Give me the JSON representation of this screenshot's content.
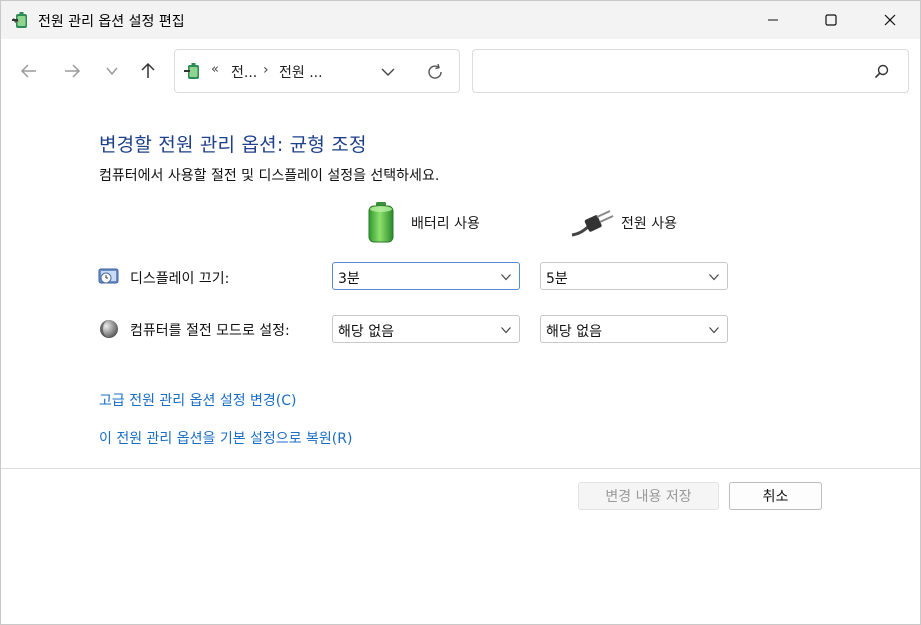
{
  "window": {
    "title": "전원 관리 옵션 설정 편집"
  },
  "address": {
    "separator_root": "«",
    "crumb1": "전...",
    "separator": "›",
    "crumb2": "전원 ..."
  },
  "search": {
    "placeholder": ""
  },
  "content": {
    "heading": "변경할 전원 관리 옵션: 균형 조정",
    "subtext": "컴퓨터에서 사용할 절전 및 디스플레이 설정을 선택하세요.",
    "columns": {
      "battery": "배터리 사용",
      "plugged": "전원 사용"
    },
    "rows": [
      {
        "label": "디스플레이 끄기:",
        "battery_value": "3분",
        "plugged_value": "5분"
      },
      {
        "label": "컴퓨터를 절전 모드로 설정:",
        "battery_value": "해당 없음",
        "plugged_value": "해당 없음"
      }
    ],
    "links": {
      "advanced": "고급 전원 관리 옵션 설정 변경(C)",
      "restore": "이 전원 관리 옵션을 기본 설정으로 복원(R)"
    }
  },
  "buttons": {
    "save": "변경 내용 저장",
    "cancel": "취소"
  },
  "icons": {
    "app": "power-options-icon",
    "back": "arrow-left-icon",
    "forward": "arrow-right-icon",
    "recent": "chevron-down-icon",
    "up": "arrow-up-icon",
    "refresh": "refresh-icon",
    "search": "search-icon",
    "battery": "battery-icon",
    "plug": "power-plug-icon",
    "display": "display-icon",
    "sleep": "sleep-moon-icon"
  },
  "colors": {
    "heading": "#1e3f8a",
    "link": "#1a6dc4",
    "focus_border": "#5a8ad6",
    "disabled_text": "#9a9a9a"
  }
}
